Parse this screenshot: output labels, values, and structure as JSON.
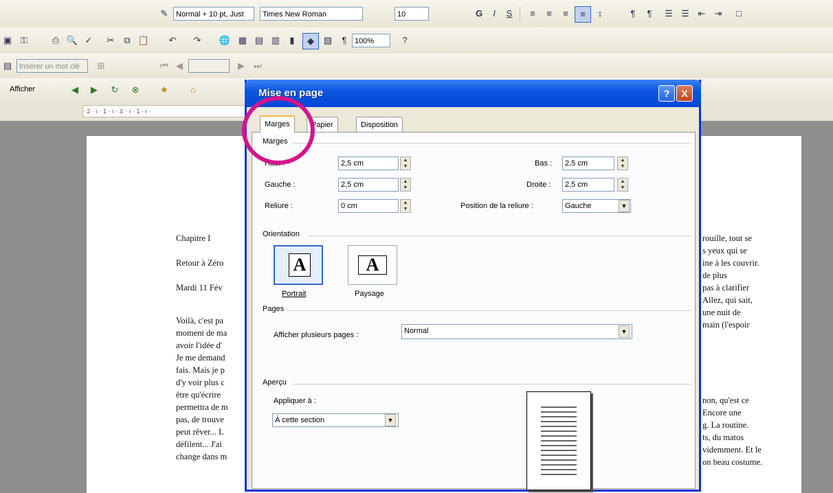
{
  "toolbar_format": {
    "style": "Normal + 10 pt, Just",
    "font": "Times New Roman",
    "size": "10",
    "bold": "G",
    "italic": "I",
    "underline": "S"
  },
  "toolbar_standard": {
    "zoom": "100%"
  },
  "toolbar_merge": {
    "insert_field": "Insérer un mot clé"
  },
  "toolbar_web": {
    "show": "Afficher"
  },
  "dialog": {
    "title": "Mise en page",
    "help": "?",
    "close": "X",
    "tabs": [
      "Marges",
      "Papier",
      "Disposition"
    ],
    "margins_group": "Marges",
    "top_label": "Haut :",
    "top_value": "2,5 cm",
    "bottom_label": "Bas :",
    "bottom_value": "2,5 cm",
    "left_label": "Gauche :",
    "left_value": "2,5 cm",
    "right_label": "Droite :",
    "right_value": "2,5 cm",
    "gutter_label": "Reliure :",
    "gutter_value": "0 cm",
    "gutter_pos_label": "Position de la reliure :",
    "gutter_pos_value": "Gauche",
    "orientation_group": "Orientation",
    "portrait": "Portrait",
    "landscape": "Paysage",
    "pages_group": "Pages",
    "multiple_pages_label": "Afficher plusieurs pages :",
    "multiple_pages_value": "Normal",
    "preview_group": "Aperçu",
    "apply_to_label": "Appliquer à :",
    "apply_to_value": "À cette section"
  },
  "document": {
    "left_lines": [
      "Chapitre I",
      "Retour à Zéro",
      "Mardi 11 Fév",
      "Voilà, c'est pa",
      "moment de ma",
      "avoir l'idée d'",
      "Je me demand",
      "fais. Mais je p",
      "d'y voir plus c",
      "être qu'écrire",
      "permettra de m",
      "pas, de trouve",
      "peut rêver... L",
      "défilent... J'ai",
      "change dans m"
    ],
    "right_lines": [
      "rouille, tout se",
      "s yeux qui se",
      "ine à les couvrir.",
      "de plus",
      "pas à clarifier",
      "Allez, qui sait,",
      "une nuit de",
      "main (l'espoir",
      "non, qu'est ce",
      "Encore une",
      "g. La routine.",
      "ts, du matos",
      "videmment. Et le",
      "on beau costume."
    ]
  }
}
